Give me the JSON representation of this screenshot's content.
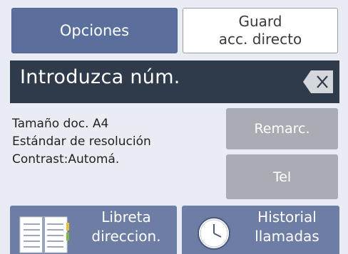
{
  "top_buttons": {
    "opciones_label": "Opciones",
    "guard_line1": "Guard",
    "guard_line2": "acc. directo"
  },
  "entry": {
    "text": "Introduzca núm.",
    "backspace_icon": "backspace-icon"
  },
  "info": {
    "line1": "Tamaño doc. A4",
    "line2": "Estándar de resolución",
    "line3": "Contrast:Automá."
  },
  "side_buttons": {
    "remarc_label": "Remarc.",
    "tel_label": "Tel"
  },
  "bottom_buttons": {
    "libreta_line1": "Libreta",
    "libreta_line2": "direccion.",
    "libreta_icon": "address-book-icon",
    "historial_line1": "Historial",
    "historial_line2": "llamadas",
    "historial_icon": "clock-icon"
  },
  "colors": {
    "primary_button": "#5b6f9d",
    "entry_bar": "#2f3b4b",
    "disabled_button": "#a9adb3",
    "bottom_button": "#6e7da3",
    "background": "#e9edf3"
  }
}
